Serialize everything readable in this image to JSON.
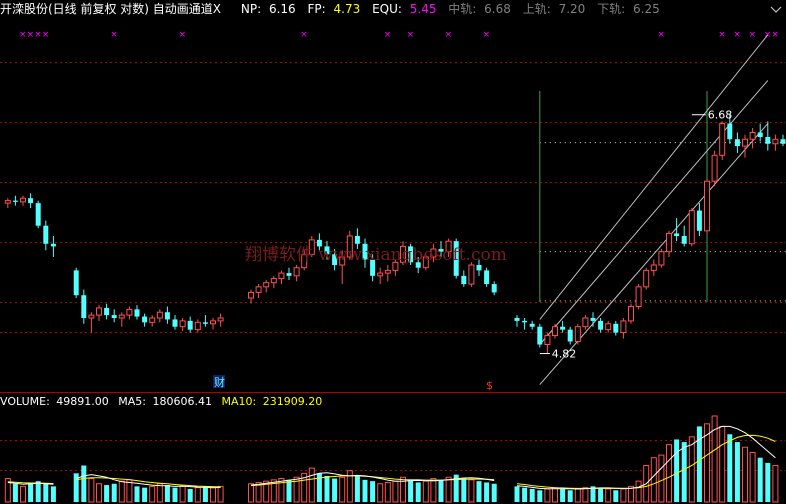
{
  "header": {
    "title": "开滦股份(日线 前复权 对数) 自动画通道X",
    "np_label": "NP:",
    "np_value": "6.16",
    "fp_label": "FP:",
    "fp_value": "4.73",
    "equ_label": "EQU:",
    "equ_value": "5.45",
    "mid_label": "中轨:",
    "mid_value": "6.68",
    "up_label": "上轨:",
    "up_value": "7.20",
    "low_label": "下轨:",
    "low_value": "6.25"
  },
  "volume_header": {
    "volume_label": "VOLUME:",
    "volume_value": "49891.00",
    "ma5_label": "MA5:",
    "ma5_value": "180606.41",
    "ma10_label": "MA10:",
    "ma10_value": "231909.20"
  },
  "watermark": "翔博软件 www.xiangbosoft.com",
  "annotations": {
    "high_label": "6.68",
    "low_label": "4.82",
    "cai_marker": "财",
    "s_marker": "$",
    "signal_mark": "×"
  },
  "colors": {
    "up": "#ff5050",
    "down": "#54ffff",
    "ma5": "#ffffff",
    "ma10": "#ffff00",
    "channel": "#c0c0c0",
    "signal": "#ff00ff",
    "grid": "#b00000"
  },
  "chart_data": {
    "type": "candlestick",
    "price_range": [
      4.7,
      7.5
    ],
    "price_scale": "log",
    "candles": [
      [
        5.92,
        5.96,
        5.88,
        5.94
      ],
      [
        5.94,
        5.98,
        5.9,
        5.93
      ],
      [
        5.93,
        5.98,
        5.9,
        5.96
      ],
      [
        5.96,
        6.0,
        5.88,
        5.92
      ],
      [
        5.92,
        5.94,
        5.72,
        5.74
      ],
      [
        5.74,
        5.78,
        5.55,
        5.6
      ],
      [
        5.6,
        5.66,
        5.5,
        5.58
      ],
      [
        null,
        null,
        null,
        null
      ],
      [
        null,
        null,
        null,
        null
      ],
      [
        5.4,
        5.42,
        5.2,
        5.22
      ],
      [
        5.22,
        5.26,
        5.02,
        5.06
      ],
      [
        5.06,
        5.1,
        4.96,
        5.08
      ],
      [
        5.08,
        5.15,
        5.04,
        5.13
      ],
      [
        5.13,
        5.16,
        5.05,
        5.08
      ],
      [
        5.08,
        5.12,
        5.03,
        5.06
      ],
      [
        5.06,
        5.1,
        5.0,
        5.08
      ],
      [
        5.08,
        5.14,
        5.05,
        5.12
      ],
      [
        5.12,
        5.15,
        5.05,
        5.07
      ],
      [
        5.07,
        5.09,
        5.0,
        5.03
      ],
      [
        5.03,
        5.08,
        5.0,
        5.06
      ],
      [
        5.06,
        5.12,
        5.03,
        5.1
      ],
      [
        5.1,
        5.14,
        5.02,
        5.05
      ],
      [
        5.05,
        5.08,
        4.98,
        5.0
      ],
      [
        5.0,
        5.06,
        4.97,
        5.04
      ],
      [
        5.04,
        5.07,
        4.96,
        4.98
      ],
      [
        4.98,
        5.05,
        4.96,
        5.03
      ],
      [
        5.03,
        5.08,
        5.0,
        5.02
      ],
      [
        5.02,
        5.06,
        4.98,
        5.04
      ],
      [
        5.04,
        5.09,
        5.0,
        5.06
      ],
      [
        null,
        null,
        null,
        null
      ],
      [
        null,
        null,
        null,
        null
      ],
      [
        null,
        null,
        null,
        null
      ],
      [
        5.2,
        5.26,
        5.16,
        5.24
      ],
      [
        5.24,
        5.3,
        5.2,
        5.28
      ],
      [
        5.28,
        5.33,
        5.24,
        5.31
      ],
      [
        5.31,
        5.36,
        5.27,
        5.34
      ],
      [
        5.34,
        5.4,
        5.3,
        5.38
      ],
      [
        5.38,
        5.42,
        5.33,
        5.36
      ],
      [
        5.36,
        5.44,
        5.32,
        5.42
      ],
      [
        5.42,
        5.55,
        5.4,
        5.52
      ],
      [
        5.52,
        5.66,
        5.5,
        5.63
      ],
      [
        5.63,
        5.68,
        5.55,
        5.58
      ],
      [
        5.58,
        5.62,
        5.48,
        5.52
      ],
      [
        5.52,
        5.56,
        5.4,
        5.44
      ],
      [
        5.44,
        5.55,
        5.3,
        5.5
      ],
      [
        5.5,
        5.7,
        5.48,
        5.66
      ],
      [
        5.66,
        5.72,
        5.56,
        5.6
      ],
      [
        5.6,
        5.64,
        5.42,
        5.48
      ],
      [
        5.48,
        5.52,
        5.32,
        5.36
      ],
      [
        5.36,
        5.42,
        5.3,
        5.38
      ],
      [
        5.38,
        5.44,
        5.32,
        5.4
      ],
      [
        5.4,
        5.48,
        5.36,
        5.46
      ],
      [
        5.46,
        5.62,
        5.44,
        5.58
      ],
      [
        5.58,
        5.6,
        5.44,
        5.46
      ],
      [
        5.46,
        5.5,
        5.38,
        5.42
      ],
      [
        5.42,
        5.52,
        5.4,
        5.5
      ],
      [
        5.5,
        5.6,
        5.46,
        5.56
      ],
      [
        5.56,
        5.62,
        5.5,
        5.54
      ],
      [
        5.54,
        5.64,
        5.5,
        5.62
      ],
      [
        5.62,
        5.64,
        5.34,
        5.36
      ],
      [
        5.36,
        5.4,
        5.28,
        5.3
      ],
      [
        5.3,
        5.46,
        5.28,
        5.44
      ],
      [
        5.44,
        5.48,
        5.36,
        5.4
      ],
      [
        5.4,
        5.42,
        5.28,
        5.3
      ],
      [
        5.3,
        5.32,
        5.22,
        5.24
      ],
      [
        null,
        null,
        null,
        null
      ],
      [
        null,
        null,
        null,
        null
      ],
      [
        5.06,
        5.08,
        5.0,
        5.04
      ],
      [
        5.04,
        5.06,
        4.98,
        5.03
      ],
      [
        5.02,
        5.04,
        4.98,
        5.0
      ],
      [
        5.0,
        5.02,
        4.86,
        4.88
      ],
      [
        4.88,
        4.96,
        4.82,
        4.94
      ],
      [
        4.94,
        5.02,
        4.92,
        5.0
      ],
      [
        5.0,
        5.04,
        4.96,
        4.98
      ],
      [
        4.98,
        5.0,
        4.88,
        4.9
      ],
      [
        4.9,
        5.02,
        4.88,
        5.0
      ],
      [
        5.0,
        5.08,
        4.98,
        5.06
      ],
      [
        5.06,
        5.1,
        5.0,
        5.04
      ],
      [
        5.04,
        5.06,
        4.96,
        4.98
      ],
      [
        4.98,
        5.04,
        4.96,
        5.02
      ],
      [
        5.02,
        5.04,
        4.94,
        4.96
      ],
      [
        4.96,
        5.06,
        4.92,
        5.04
      ],
      [
        5.04,
        5.16,
        5.02,
        5.14
      ],
      [
        5.14,
        5.3,
        5.12,
        5.28
      ],
      [
        5.28,
        5.42,
        5.26,
        5.4
      ],
      [
        5.4,
        5.48,
        5.36,
        5.44
      ],
      [
        5.44,
        5.56,
        5.42,
        5.54
      ],
      [
        5.54,
        5.7,
        5.5,
        5.68
      ],
      [
        5.68,
        5.8,
        5.62,
        5.66
      ],
      [
        5.66,
        5.74,
        5.58,
        5.6
      ],
      [
        5.6,
        5.88,
        5.58,
        5.86
      ],
      [
        5.86,
        5.92,
        5.66,
        5.7
      ],
      [
        5.7,
        6.12,
        5.68,
        6.1
      ],
      [
        6.1,
        6.36,
        6.06,
        6.32
      ],
      [
        6.32,
        6.62,
        6.28,
        6.6
      ],
      [
        6.6,
        6.68,
        6.42,
        6.46
      ],
      [
        6.46,
        6.52,
        6.34,
        6.4
      ],
      [
        6.4,
        6.5,
        6.3,
        6.46
      ],
      [
        6.46,
        6.56,
        6.38,
        6.52
      ],
      [
        6.52,
        6.6,
        6.44,
        6.48
      ],
      [
        6.48,
        6.62,
        6.36,
        6.42
      ],
      [
        6.42,
        6.5,
        6.36,
        6.46
      ],
      [
        6.46,
        6.5,
        6.4,
        6.42
      ],
      [
        6.42,
        6.48,
        6.4,
        6.44
      ]
    ],
    "volume": [
      90,
      70,
      60,
      75,
      80,
      70,
      60,
      0,
      0,
      110,
      140,
      90,
      70,
      65,
      70,
      80,
      85,
      60,
      55,
      60,
      70,
      65,
      55,
      60,
      50,
      55,
      60,
      55,
      60,
      0,
      0,
      0,
      70,
      75,
      80,
      85,
      90,
      85,
      95,
      110,
      130,
      110,
      100,
      90,
      95,
      120,
      100,
      85,
      80,
      70,
      75,
      80,
      95,
      85,
      75,
      80,
      90,
      85,
      95,
      105,
      90,
      85,
      80,
      75,
      70,
      0,
      0,
      60,
      55,
      50,
      45,
      50,
      55,
      50,
      45,
      50,
      55,
      60,
      55,
      50,
      45,
      50,
      60,
      80,
      140,
      170,
      180,
      220,
      240,
      230,
      250,
      290,
      300,
      330,
      290,
      260,
      230,
      210,
      190,
      170,
      150,
      140
    ],
    "ma5": [
      75,
      72,
      68,
      70,
      72,
      70,
      68,
      0,
      0,
      90,
      100,
      105,
      100,
      95,
      85,
      78,
      75,
      72,
      68,
      65,
      63,
      62,
      60,
      61,
      59,
      57,
      56,
      55,
      56,
      0,
      0,
      0,
      65,
      68,
      72,
      76,
      80,
      84,
      87,
      93,
      102,
      110,
      112,
      108,
      103,
      100,
      102,
      100,
      96,
      90,
      84,
      80,
      80,
      82,
      83,
      82,
      81,
      83,
      85,
      89,
      92,
      93,
      91,
      87,
      82,
      0,
      0,
      62,
      60,
      56,
      52,
      51,
      51,
      51,
      51,
      50,
      51,
      53,
      54,
      54,
      53,
      52,
      52,
      57,
      70,
      100,
      130,
      160,
      190,
      210,
      220,
      240,
      258,
      278,
      290,
      290,
      281,
      266,
      245,
      220,
      195,
      170
    ],
    "ma10": [
      78,
      76,
      74,
      73,
      73,
      72,
      71,
      0,
      0,
      85,
      90,
      93,
      93,
      92,
      90,
      88,
      86,
      82,
      78,
      75,
      72,
      70,
      67,
      65,
      63,
      61,
      60,
      59,
      58,
      0,
      0,
      0,
      63,
      65,
      68,
      71,
      74,
      77,
      80,
      84,
      88,
      92,
      96,
      98,
      100,
      100,
      100,
      99,
      97,
      94,
      91,
      88,
      86,
      85,
      85,
      84,
      84,
      84,
      85,
      86,
      87,
      88,
      88,
      87,
      86,
      0,
      0,
      70,
      67,
      63,
      60,
      57,
      55,
      54,
      53,
      52,
      52,
      52,
      52,
      52,
      52,
      52,
      53,
      55,
      60,
      70,
      82,
      95,
      110,
      125,
      140,
      160,
      180,
      200,
      220,
      235,
      248,
      255,
      256,
      253,
      245,
      232
    ],
    "volume_max": 330,
    "channel_lines": [
      {
        "name": "upper",
        "from": [
          70,
          5.05
        ],
        "to": [
          100,
          7.45
        ]
      },
      {
        "name": "middle",
        "from": [
          70,
          4.88
        ],
        "to": [
          100,
          7.0
        ]
      },
      {
        "name": "lower",
        "from": [
          70,
          4.62
        ],
        "to": [
          100,
          6.6
        ]
      }
    ],
    "signal_columns": [
      2,
      3,
      4,
      5,
      14,
      23,
      39,
      50,
      53,
      58,
      63,
      86,
      94,
      96,
      98,
      100,
      101
    ],
    "dotted_levels": [
      6.43,
      5.54,
      5.18
    ],
    "vertical_markers": [
      70,
      92
    ],
    "high_point": {
      "index": 90,
      "price": 6.68
    },
    "low_point": {
      "index": 70,
      "price": 4.82
    }
  }
}
